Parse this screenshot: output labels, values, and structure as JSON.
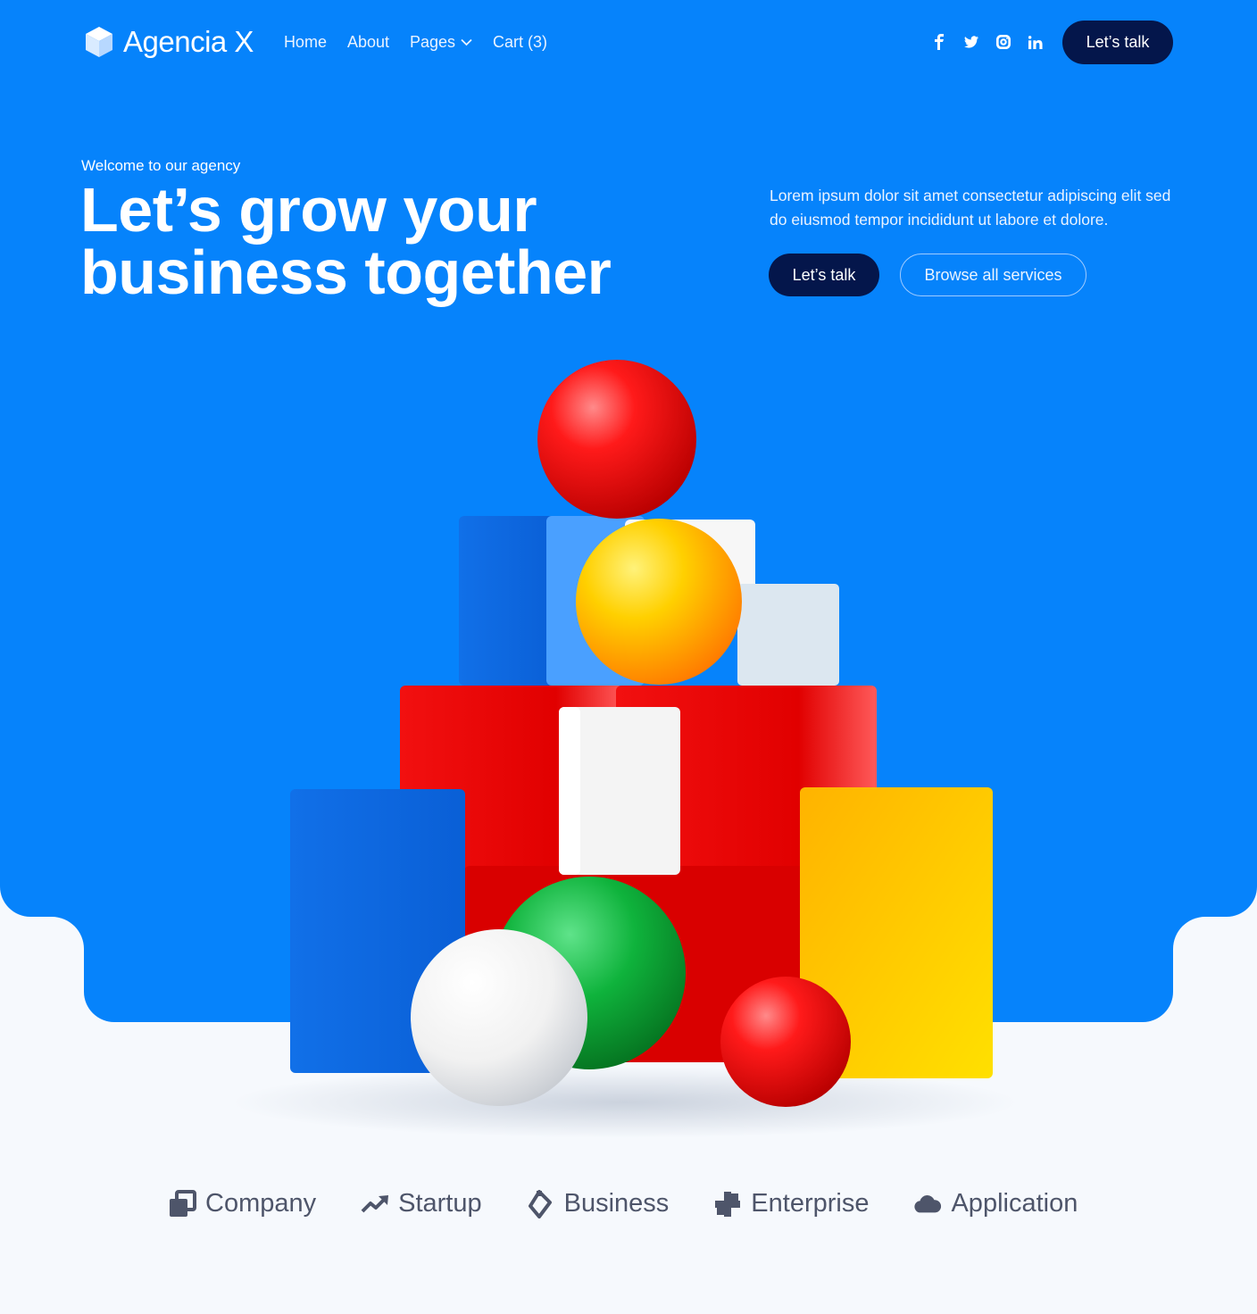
{
  "brand": {
    "name": "Agencia X",
    "accent": "#0683fb",
    "dark": "#04164b"
  },
  "nav": {
    "items": [
      {
        "label": "Home"
      },
      {
        "label": "About"
      },
      {
        "label": "Pages"
      },
      {
        "label": "Cart (3)"
      }
    ]
  },
  "socials": [
    "facebook-icon",
    "twitter-icon",
    "instagram-icon",
    "linkedin-icon"
  ],
  "header": {
    "cta": "Let’s talk"
  },
  "hero": {
    "eyebrow": "Welcome to our agency",
    "headline_line1": "Let’s grow your",
    "headline_line2": "business together",
    "description": "Lorem ipsum dolor sit amet consectetur adipiscing elit sed do eiusmod tempor incididunt ut labore et dolore.",
    "primary_cta": "Let’s talk",
    "secondary_cta": "Browse all services"
  },
  "categories": [
    {
      "label": "Company",
      "icon": "company-icon"
    },
    {
      "label": "Startup",
      "icon": "trending-up-icon"
    },
    {
      "label": "Business",
      "icon": "diamond-icon"
    },
    {
      "label": "Enterprise",
      "icon": "puzzle-icon"
    },
    {
      "label": "Application",
      "icon": "cloud-icon"
    }
  ]
}
